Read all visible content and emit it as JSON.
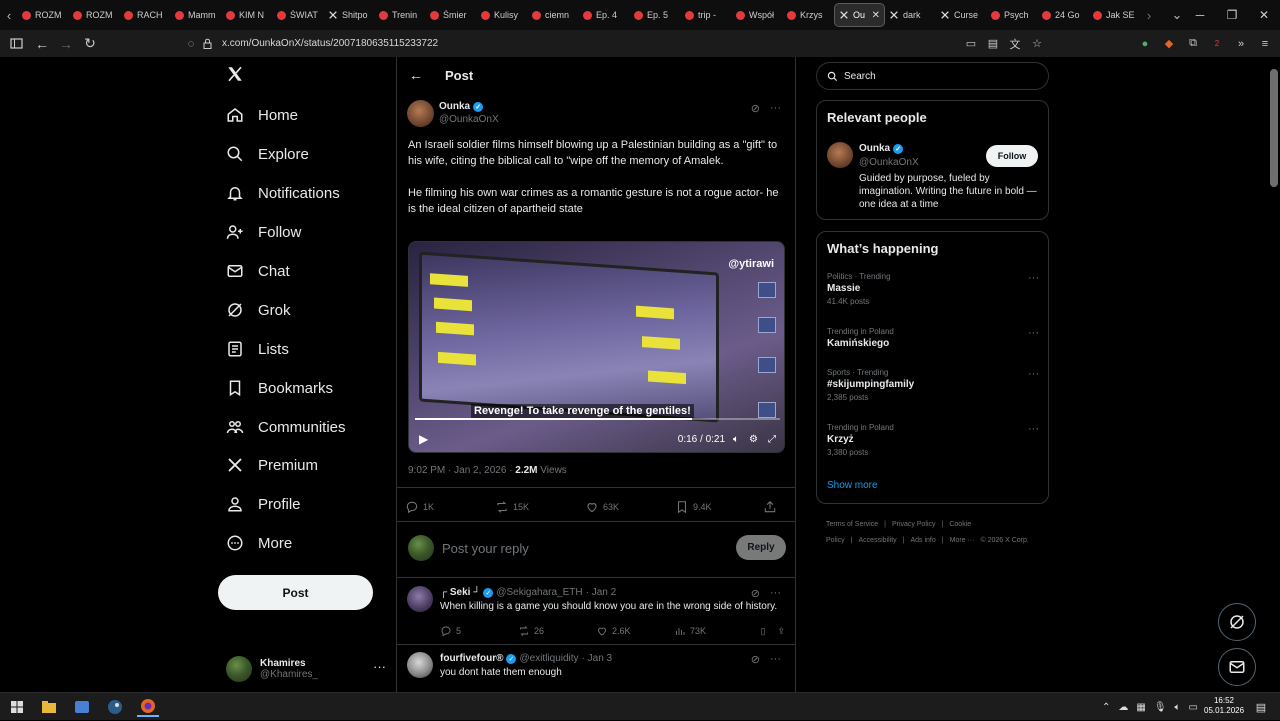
{
  "browser": {
    "tabs": [
      {
        "label": "ROZM",
        "color": "#e33b3b"
      },
      {
        "label": "ROZM",
        "color": "#e33b3b"
      },
      {
        "label": "RACH",
        "color": "#e33b3b"
      },
      {
        "label": "Mamm",
        "color": "#e33b3b"
      },
      {
        "label": "KIM N",
        "color": "#e33b3b"
      },
      {
        "label": "ŚWIAT",
        "color": "#e33b3b"
      },
      {
        "label": "Shitpo",
        "color": "x"
      },
      {
        "label": "Trenin",
        "color": "#e33b3b"
      },
      {
        "label": "Śmier",
        "color": "#e33b3b"
      },
      {
        "label": "Kulisy",
        "color": "#e33b3b"
      },
      {
        "label": "ciemn",
        "color": "#e33b3b"
      },
      {
        "label": "Ep. 4",
        "color": "#e33b3b"
      },
      {
        "label": "Ep. 5",
        "color": "#e33b3b"
      },
      {
        "label": "trip -",
        "color": "#e33b3b"
      },
      {
        "label": "Współ",
        "color": "#e33b3b"
      },
      {
        "label": "Krzys",
        "color": "#e33b3b"
      },
      {
        "label": "Ou",
        "color": "x",
        "active": true
      },
      {
        "label": "dark",
        "color": "x"
      },
      {
        "label": "Curse",
        "color": "x"
      },
      {
        "label": "Psych",
        "color": "#e33b3b"
      },
      {
        "label": "24 Go",
        "color": "#e33b3b"
      },
      {
        "label": "Jak SE",
        "color": "#e33b3b"
      }
    ],
    "url": "x.com/OunkaOnX/status/2007180635115233722",
    "ext_badge": "2"
  },
  "nav": {
    "items": [
      {
        "label": "Home",
        "icon": "home-icon"
      },
      {
        "label": "Explore",
        "icon": "search-icon"
      },
      {
        "label": "Notifications",
        "icon": "bell-icon"
      },
      {
        "label": "Follow",
        "icon": "follow-icon"
      },
      {
        "label": "Chat",
        "icon": "mail-icon"
      },
      {
        "label": "Grok",
        "icon": "grok-icon"
      },
      {
        "label": "Lists",
        "icon": "list-icon"
      },
      {
        "label": "Bookmarks",
        "icon": "bookmark-icon"
      },
      {
        "label": "Communities",
        "icon": "communities-icon"
      },
      {
        "label": "Premium",
        "icon": "x-logo-icon"
      },
      {
        "label": "Profile",
        "icon": "person-icon"
      },
      {
        "label": "More",
        "icon": "more-circle-icon"
      }
    ],
    "post_label": "Post",
    "account": {
      "name": "Khamires",
      "handle": "@Khamires_"
    }
  },
  "post": {
    "header_title": "Post",
    "author": {
      "name": "Ounka",
      "handle": "@OunkaOnX"
    },
    "paragraphs": [
      "An Israeli soldier films himself blowing up a Palestinian building as a \"gift\" to his wife, citing the biblical call to \"wipe off the memory of Amalek.",
      "He filming his own war crimes as a romantic gesture is not a rogue actor- he is the ideal citizen of apartheid state"
    ],
    "video": {
      "tag": "@ytirawi",
      "caption": "Revenge! To take revenge of the gentiles!",
      "time": "0:16 / 0:21",
      "progress": 0.76
    },
    "meta": {
      "time": "9:02 PM · Jan 2, 2026 · ",
      "views_count": "2.2M",
      "views_label": " Views"
    },
    "stats": {
      "replies": "1K",
      "reposts": "15K",
      "likes": "63K",
      "bookmarks": "9.4K"
    }
  },
  "reply_box": {
    "placeholder": "Post your reply",
    "button": "Reply"
  },
  "replies": [
    {
      "name": "┌ Seki ┘",
      "handle": "@Sekigahara_ETH",
      "date": "· Jan 2",
      "text": "When killing is a game you should know you are in the wrong side of history.",
      "replies": "5",
      "reposts": "26",
      "likes": "2.6K",
      "views": "73K"
    },
    {
      "name": "fourfivefour®",
      "handle": "@exitliquidity",
      "date": "· Jan 3",
      "text": "you dont hate them enough",
      "replies": "",
      "reposts": "",
      "likes": "",
      "views": ""
    }
  ],
  "sidebar": {
    "search_placeholder": "Search",
    "relevant": {
      "title": "Relevant people",
      "name": "Ounka",
      "handle": "@OunkaOnX",
      "bio": "Guided by purpose, fueled by imagination. Writing the future in bold — one idea at a time",
      "follow": "Follow"
    },
    "happening": {
      "title": "What’s happening",
      "trends": [
        {
          "context": "Politics · Trending",
          "name": "Massie",
          "posts": "41.4K posts"
        },
        {
          "context": "Trending in Poland",
          "name": "Kamińskiego",
          "posts": ""
        },
        {
          "context": "Sports · Trending",
          "name": "#skijumpingfamily",
          "posts": "2,385 posts"
        },
        {
          "context": "Trending in Poland",
          "name": "Krzyż",
          "posts": "3,380 posts"
        }
      ],
      "show_more": "Show more"
    },
    "footer": [
      "Terms of Service",
      "|",
      "Privacy Policy",
      "|",
      "Cookie Policy",
      "|",
      "Accessibility",
      "|",
      "Ads info",
      "|",
      "More ···",
      "© 2026 X Corp."
    ]
  },
  "taskbar": {
    "time": "16:52",
    "date": "05.01.2026"
  }
}
